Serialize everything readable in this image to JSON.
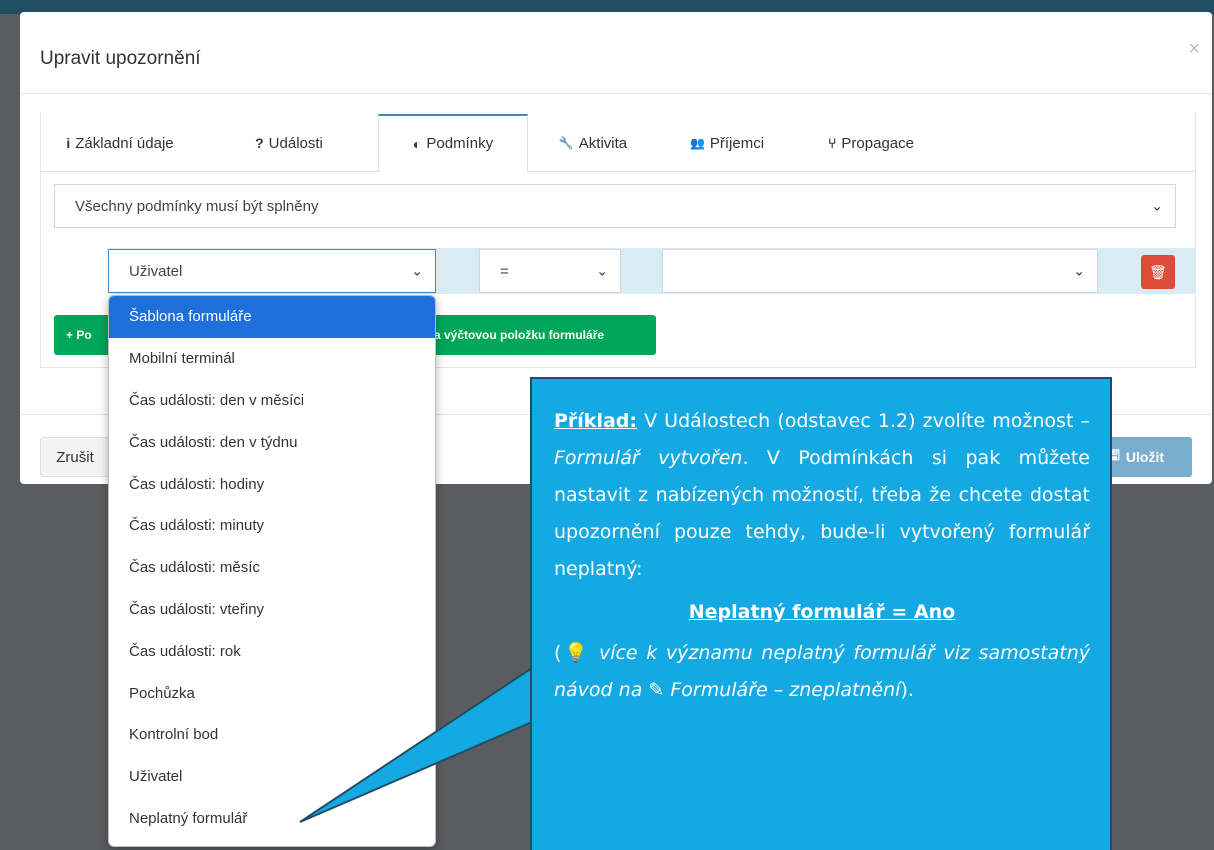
{
  "modal": {
    "title": "Upravit upozornění",
    "close": "×"
  },
  "tabs": [
    {
      "icon": "i",
      "label": "Základní údaje"
    },
    {
      "icon": "?",
      "label": "Události"
    },
    {
      "icon": "◐",
      "label": "Podmínky"
    },
    {
      "icon": "🔧",
      "label": "Aktivita"
    },
    {
      "icon": "👥",
      "label": "Příjemci"
    },
    {
      "icon": "⑂",
      "label": "Propagace"
    }
  ],
  "conditions": {
    "mode": "Všechny podmínky musí být splněny",
    "field": "Uživatel",
    "operator": "=",
    "value": ""
  },
  "buttons": {
    "add_prefix": "+ Po",
    "add_form_item": "a výčtovou položku formuláře",
    "cancel": "Zrušit",
    "save": "Uložit"
  },
  "dropdown": {
    "items": [
      "Šablona formuláře",
      "Mobilní terminál",
      "Čas události: den v měsíci",
      "Čas události: den v týdnu",
      "Čas události: hodiny",
      "Čas události: minuty",
      "Čas události: měsíc",
      "Čas události: vteřiny",
      "Čas události: rok",
      "Pochůzka",
      "Kontrolní bod",
      "Uživatel",
      "Neplatný formulář"
    ],
    "selected_index": 0
  },
  "callout": {
    "example_label": "Příklad:",
    "p1_a": " V Událostech (odstavec 1.2) zvolíte možnost – ",
    "p1_em": "Formulář vytvořen",
    "p1_b": ". V Podmínkách si pak můžete nastavit z nabízených možností, třeba že chcete dostat upozornění pouze tehdy, bude-li vytvořený formulář neplatný:",
    "rule": "Neplatný formulář  =  Ano",
    "note_open": "(",
    "note_em1": " více k významu neplatný formulář viz samostatný návod na ",
    "note_em2": " Formuláře – zneplatnění",
    "note_close": ")."
  },
  "colors": {
    "accent": "#3c8dbc",
    "selected": "#1e6fd9",
    "callout": "#14a9e3",
    "danger": "#dd4b39",
    "success": "#00a65a"
  }
}
